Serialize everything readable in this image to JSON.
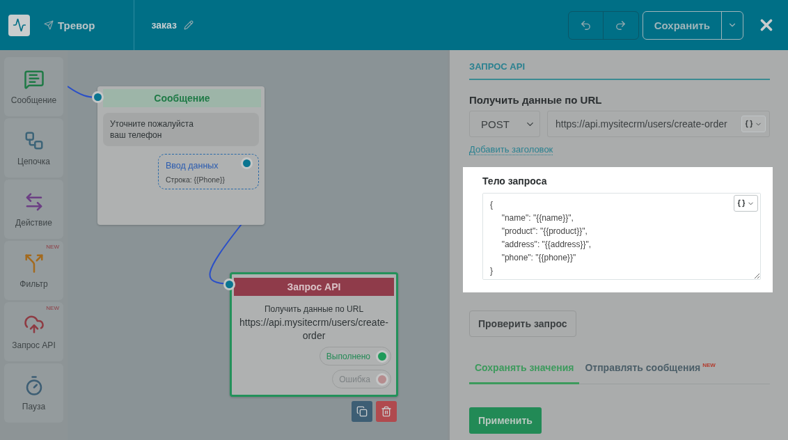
{
  "header": {
    "bot_name": "Тревор",
    "flow_name": "заказ",
    "save_button": "Сохранить"
  },
  "sidebar": {
    "items": [
      {
        "kind": "message",
        "label": "Сообщение"
      },
      {
        "kind": "chain",
        "label": "Цепочка"
      },
      {
        "kind": "action",
        "label": "Действие"
      },
      {
        "kind": "filter",
        "label": "Фильтр",
        "badge": "NEW"
      },
      {
        "kind": "api",
        "label": "Запрос API",
        "badge": "NEW"
      },
      {
        "kind": "pause",
        "label": "Пауза"
      }
    ]
  },
  "canvas": {
    "message_node": {
      "title": "Сообщение",
      "text": "Уточните пожалуйста ваш телефон",
      "input": {
        "title": "Ввод данных",
        "value": "Строка: {{Phone}}"
      }
    },
    "api_node": {
      "title": "Запрос API",
      "subtitle": "Получить данные по URL",
      "url": "https://api.mysitecrm/users/create-order",
      "outputs": [
        {
          "kind": "success",
          "label": "Выполнено"
        },
        {
          "kind": "error",
          "label": "Ошибка"
        }
      ]
    }
  },
  "panel": {
    "section_title": "ЗАПРОС API",
    "url_label": "Получить данные по URL",
    "method": "POST",
    "url": "https://api.mysitecrm/users/create-order",
    "add_header_link": "Добавить заголовок",
    "body_label": "Тело запроса",
    "body": "{\n\t\"name\": \"{{name}}\",\n\t\"product\": \"{{product}}\",\n\t\"address\": \"{{address}}\",\n\t\"phone\": \"{{phone}}\"\n}",
    "check_button": "Проверить запрос",
    "tabs": [
      {
        "label": "Сохранять значения",
        "selected": true
      },
      {
        "label": "Отправлять сообщения",
        "selected": false,
        "badge": "NEW"
      }
    ],
    "apply_button": "Применить"
  }
}
